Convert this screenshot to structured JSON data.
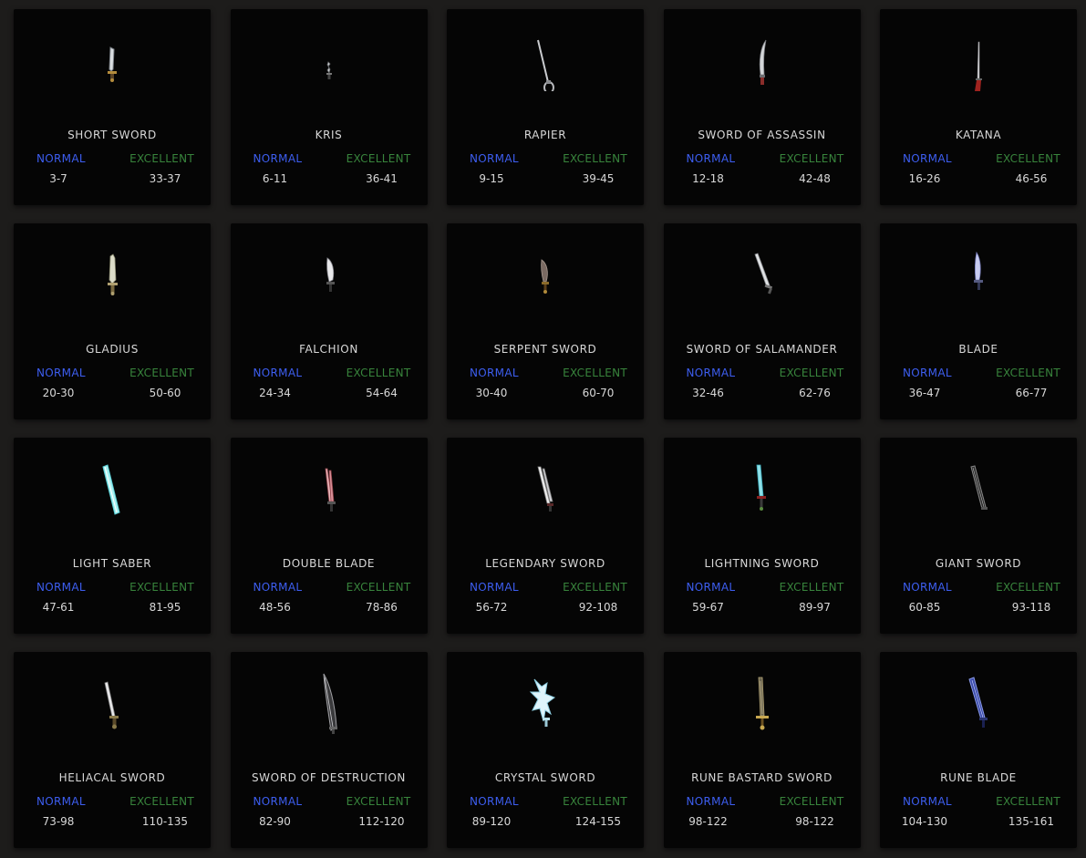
{
  "labels": {
    "normal": "NORMAL",
    "excellent": "EXCELLENT"
  },
  "colors": {
    "background": "#1d1c1b",
    "card": "#050505",
    "normal_label": "#3d5ef0",
    "excellent_label": "#38843c",
    "text": "#d8d8d8"
  },
  "weapons": [
    {
      "name": "SHORT SWORD",
      "normal": "3-7",
      "excellent": "33-37",
      "icon": "short-sword-icon"
    },
    {
      "name": "KRIS",
      "normal": "6-11",
      "excellent": "36-41",
      "icon": "kris-icon"
    },
    {
      "name": "RAPIER",
      "normal": "9-15",
      "excellent": "39-45",
      "icon": "rapier-icon"
    },
    {
      "name": "SWORD OF ASSASSIN",
      "normal": "12-18",
      "excellent": "42-48",
      "icon": "sword-of-assassin-icon"
    },
    {
      "name": "KATANA",
      "normal": "16-26",
      "excellent": "46-56",
      "icon": "katana-icon"
    },
    {
      "name": "GLADIUS",
      "normal": "20-30",
      "excellent": "50-60",
      "icon": "gladius-icon"
    },
    {
      "name": "FALCHION",
      "normal": "24-34",
      "excellent": "54-64",
      "icon": "falchion-icon"
    },
    {
      "name": "SERPENT SWORD",
      "normal": "30-40",
      "excellent": "60-70",
      "icon": "serpent-sword-icon"
    },
    {
      "name": "SWORD OF SALAMANDER",
      "normal": "32-46",
      "excellent": "62-76",
      "icon": "sword-of-salamander-icon"
    },
    {
      "name": "BLADE",
      "normal": "36-47",
      "excellent": "66-77",
      "icon": "blade-icon"
    },
    {
      "name": "LIGHT SABER",
      "normal": "47-61",
      "excellent": "81-95",
      "icon": "light-saber-icon"
    },
    {
      "name": "DOUBLE BLADE",
      "normal": "48-56",
      "excellent": "78-86",
      "icon": "double-blade-icon"
    },
    {
      "name": "LEGENDARY SWORD",
      "normal": "56-72",
      "excellent": "92-108",
      "icon": "legendary-sword-icon"
    },
    {
      "name": "LIGHTNING SWORD",
      "normal": "59-67",
      "excellent": "89-97",
      "icon": "lightning-sword-icon"
    },
    {
      "name": "GIANT SWORD",
      "normal": "60-85",
      "excellent": "93-118",
      "icon": "giant-sword-icon"
    },
    {
      "name": "HELIACAL SWORD",
      "normal": "73-98",
      "excellent": "110-135",
      "icon": "heliacal-sword-icon"
    },
    {
      "name": "SWORD OF DESTRUCTION",
      "normal": "82-90",
      "excellent": "112-120",
      "icon": "sword-of-destruction-icon"
    },
    {
      "name": "CRYSTAL SWORD",
      "normal": "89-120",
      "excellent": "124-155",
      "icon": "crystal-sword-icon"
    },
    {
      "name": "RUNE BASTARD SWORD",
      "normal": "98-122",
      "excellent": "98-122",
      "icon": "rune-bastard-sword-icon"
    },
    {
      "name": "RUNE BLADE",
      "normal": "104-130",
      "excellent": "135-161",
      "icon": "rune-blade-icon"
    }
  ]
}
